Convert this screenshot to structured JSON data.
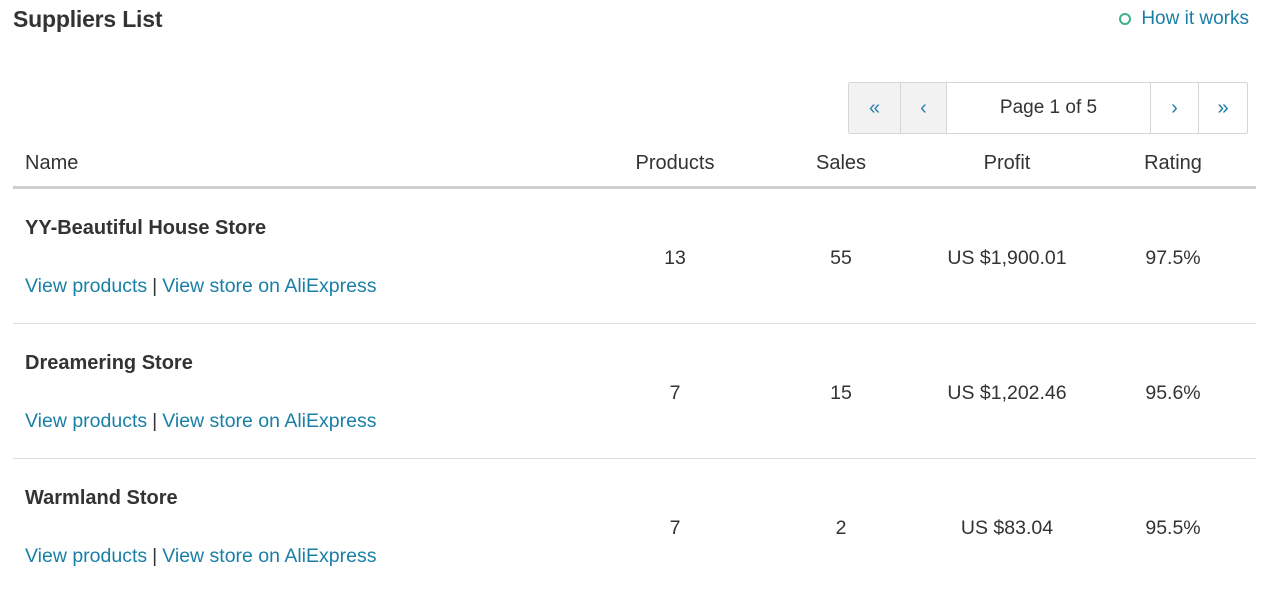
{
  "header": {
    "title": "Suppliers List",
    "help_link": "How it works"
  },
  "pagination": {
    "first": "«",
    "prev": "‹",
    "page_label": "Page 1 of 5",
    "next": "›",
    "last": "»"
  },
  "table": {
    "columns": [
      "Name",
      "Products",
      "Sales",
      "Profit",
      "Rating"
    ],
    "rows": [
      {
        "name": "YY-Beautiful House Store",
        "view_products": "View products",
        "separator": "|",
        "view_store": "View store on AliExpress",
        "products": "13",
        "sales": "55",
        "profit": "US $1,900.01",
        "rating": "97.5%"
      },
      {
        "name": "Dreamering Store",
        "view_products": "View products",
        "separator": "|",
        "view_store": "View store on AliExpress",
        "products": "7",
        "sales": "15",
        "profit": "US $1,202.46",
        "rating": "95.6%"
      },
      {
        "name": "Warmland Store",
        "view_products": "View products",
        "separator": "|",
        "view_store": "View store on AliExpress",
        "products": "7",
        "sales": "2",
        "profit": "US $83.04",
        "rating": "95.5%"
      }
    ]
  },
  "colors": {
    "link": "#1a7fa6",
    "help_icon": "#3eb08e",
    "text": "#333333"
  }
}
